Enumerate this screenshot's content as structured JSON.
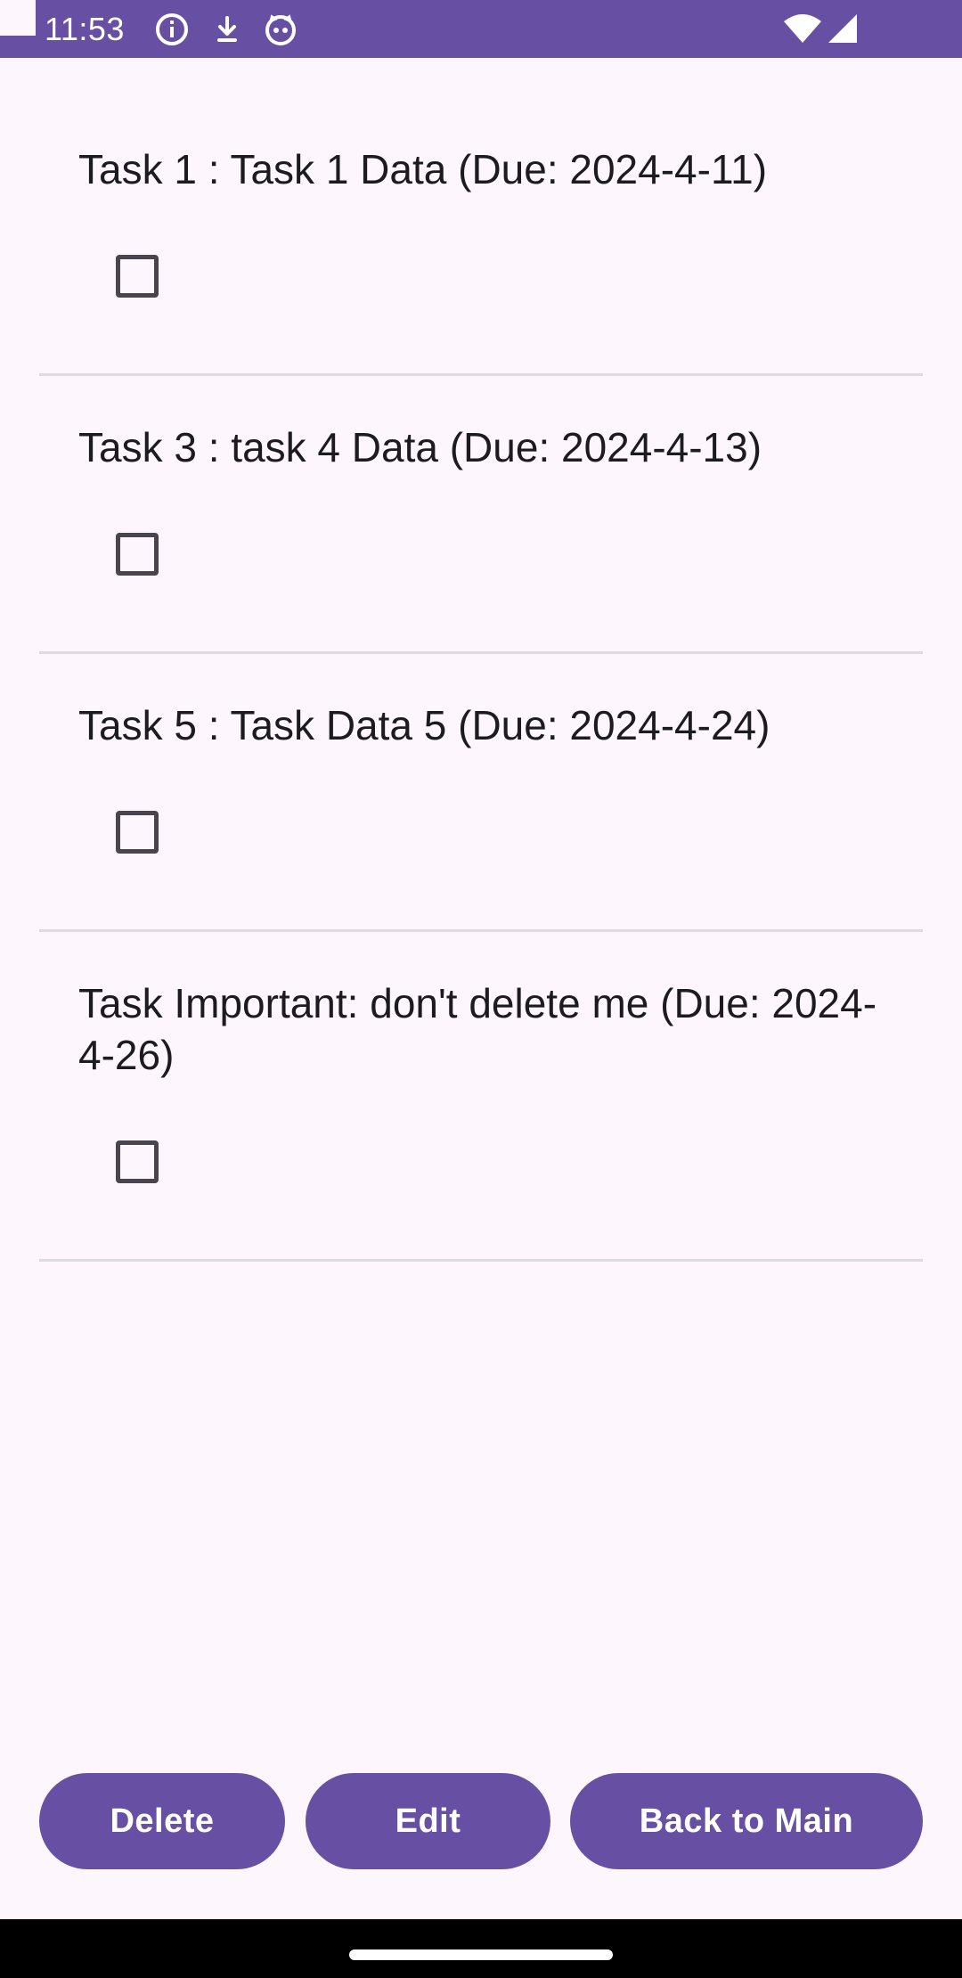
{
  "status_bar": {
    "time": "11:53",
    "left_icons": [
      "info-icon",
      "download-icon",
      "cat-face-icon"
    ],
    "right_icons": [
      "wifi-icon",
      "signal-icon"
    ]
  },
  "tasks": [
    {
      "label": "Task 1 : Task 1 Data (Due: 2024-4-11)",
      "checked": false
    },
    {
      "label": "Task 3 : task 4 Data (Due: 2024-4-13)",
      "checked": false
    },
    {
      "label": "Task 5 : Task Data 5  (Due: 2024-4-24)",
      "checked": false
    },
    {
      "label": "Task Important:  don't delete me (Due: 2024-4-26)",
      "checked": false
    }
  ],
  "buttons": {
    "delete": "Delete",
    "edit": "Edit",
    "back": "Back to Main"
  },
  "colors": {
    "accent": "#6750a4",
    "background": "#fdf7fd",
    "divider": "#dcdcdc",
    "text": "#1c1b1f"
  }
}
